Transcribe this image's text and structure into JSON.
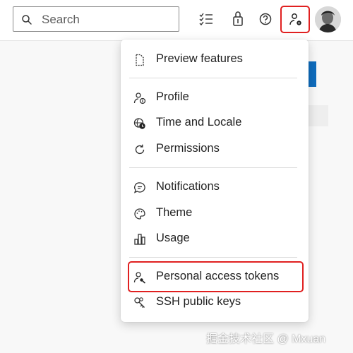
{
  "search": {
    "placeholder": "Search",
    "icon": "search-icon"
  },
  "toolbar": {
    "icons": [
      "task-list-icon",
      "shopping-bag-icon",
      "help-icon",
      "user-settings-icon"
    ]
  },
  "menu": {
    "items": [
      {
        "label": "Preview features",
        "icon": "document-icon"
      },
      {
        "label": "Profile",
        "icon": "profile-icon"
      },
      {
        "label": "Time and Locale",
        "icon": "globe-clock-icon"
      },
      {
        "label": "Permissions",
        "icon": "refresh-icon"
      },
      {
        "label": "Notifications",
        "icon": "chat-bubble-icon"
      },
      {
        "label": "Theme",
        "icon": "palette-icon"
      },
      {
        "label": "Usage",
        "icon": "bar-chart-icon"
      },
      {
        "label": "Personal access tokens",
        "icon": "person-key-icon"
      },
      {
        "label": "SSH public keys",
        "icon": "key-icon"
      }
    ]
  },
  "watermark": "掘金技术社区 @ Mxuan",
  "colors": {
    "highlight": "#e02020",
    "accent": "#0f6cbd"
  }
}
